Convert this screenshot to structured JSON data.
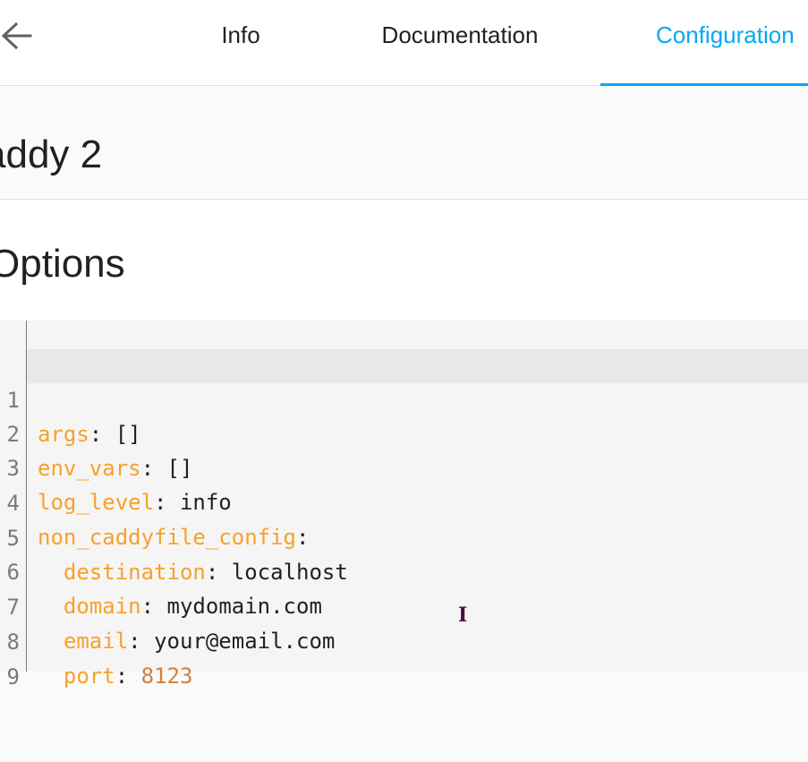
{
  "header": {
    "back_icon": "arrow-left-icon",
    "tabs": [
      {
        "label": "Info",
        "active": false
      },
      {
        "label": "Documentation",
        "active": false
      },
      {
        "label": "Configuration",
        "active": true
      }
    ],
    "accent_color": "#03a9f4"
  },
  "page": {
    "title": "addy 2"
  },
  "options": {
    "heading": "Options",
    "editor": {
      "lines": [
        {
          "num": "1",
          "indent": "",
          "key": "args",
          "sep": ": ",
          "value": "[]",
          "value_type": "plain"
        },
        {
          "num": "2",
          "indent": "",
          "key": "env_vars",
          "sep": ": ",
          "value": "[]",
          "value_type": "plain"
        },
        {
          "num": "3",
          "indent": "",
          "key": "log_level",
          "sep": ": ",
          "value": "info",
          "value_type": "plain"
        },
        {
          "num": "4",
          "indent": "",
          "key": "non_caddyfile_config",
          "sep": ":",
          "value": "",
          "value_type": "plain"
        },
        {
          "num": "5",
          "indent": "  ",
          "key": "destination",
          "sep": ": ",
          "value": "localhost",
          "value_type": "plain"
        },
        {
          "num": "6",
          "indent": "  ",
          "key": "domain",
          "sep": ": ",
          "value": "mydomain.com",
          "value_type": "plain"
        },
        {
          "num": "7",
          "indent": "  ",
          "key": "email",
          "sep": ": ",
          "value": "your@email.com",
          "value_type": "plain"
        },
        {
          "num": "8",
          "indent": "  ",
          "key": "port",
          "sep": ": ",
          "value": "8123",
          "value_type": "number"
        },
        {
          "num": "9",
          "indent": "",
          "key": "",
          "sep": "",
          "value": "",
          "value_type": "plain"
        }
      ],
      "active_line": "1",
      "key_color": "#f7a12b",
      "number_color": "#d2813c"
    },
    "text_cursor": "I"
  }
}
